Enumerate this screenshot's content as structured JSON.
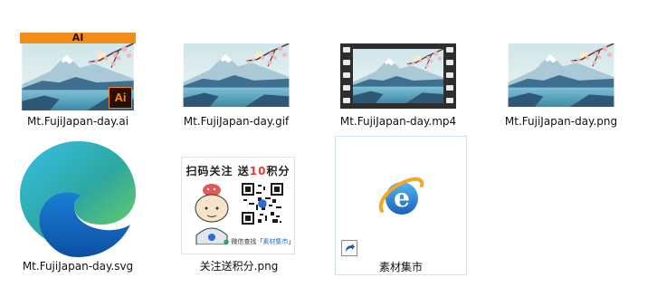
{
  "explorer": {
    "view": "large-icons",
    "files": [
      {
        "name": "Mt.FujiJapan-day.ai",
        "type": "ai",
        "badge_header": "AI",
        "badge_mark": "Ai",
        "icon": "illustrator-file-icon"
      },
      {
        "name": "Mt.FujiJapan-day.gif",
        "type": "gif",
        "icon": "image-thumbnail-icon"
      },
      {
        "name": "Mt.FujiJapan-day.mp4",
        "type": "mp4",
        "icon": "video-filmstrip-icon"
      },
      {
        "name": "Mt.FujiJapan-day.png",
        "type": "png",
        "icon": "image-thumbnail-icon"
      },
      {
        "name": "Mt.FujiJapan-day.svg",
        "type": "svg",
        "icon": "edge-browser-icon"
      },
      {
        "name": "关注送积分.png",
        "type": "png",
        "icon": "qr-code-icon",
        "thumb_title_prefix": "扫码关注 送",
        "thumb_title_highlight": "10",
        "thumb_title_suffix": "积分",
        "thumb_footer_prefix": "微信查找「",
        "thumb_footer_accent": "素材集市",
        "thumb_footer_suffix": "」"
      },
      {
        "name": "素材集市",
        "type": "shortcut",
        "icon": "internet-explorer-icon",
        "selected": true
      }
    ]
  },
  "colors": {
    "sky": "#dceef0",
    "water": "#5fa9c4",
    "mountain_dark": "#3f6f90",
    "blossom": "#f2b6bd",
    "branch": "#5b3a3a",
    "ai_orange": "#f28c1b",
    "selection_border": "#cfe5f7"
  }
}
